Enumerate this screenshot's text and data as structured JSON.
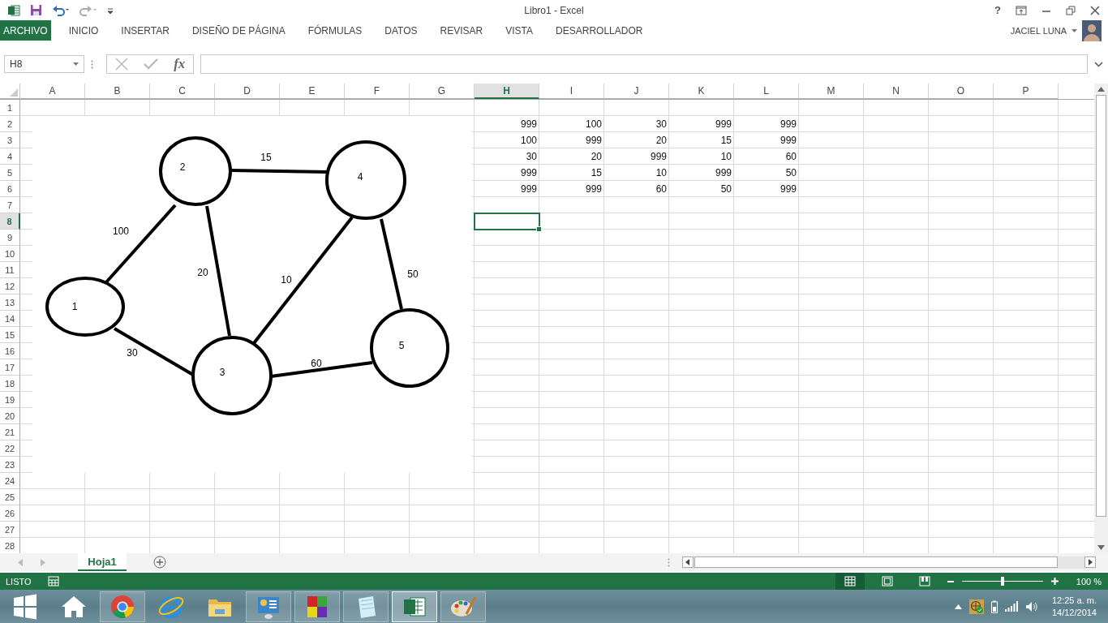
{
  "title_bar": {
    "title": "Libro1 - Excel",
    "help": "?"
  },
  "ribbon_tabs": [
    {
      "label": "ARCHIVO",
      "kind": "file"
    },
    {
      "label": "INICIO",
      "kind": "tab"
    },
    {
      "label": "INSERTAR",
      "kind": "tab"
    },
    {
      "label": "DISEÑO DE PÁGINA",
      "kind": "tab"
    },
    {
      "label": "FÓRMULAS",
      "kind": "tab"
    },
    {
      "label": "DATOS",
      "kind": "tab"
    },
    {
      "label": "REVISAR",
      "kind": "tab"
    },
    {
      "label": "VISTA",
      "kind": "tab"
    },
    {
      "label": "DESARROLLADOR",
      "kind": "tab"
    }
  ],
  "user": {
    "name": "JACIEL LUNA"
  },
  "formula_bar": {
    "name_box": "H8",
    "function_button": "fx"
  },
  "columns": [
    {
      "label": "A",
      "selected": false
    },
    {
      "label": "B",
      "selected": false
    },
    {
      "label": "C",
      "selected": false
    },
    {
      "label": "D",
      "selected": false
    },
    {
      "label": "E",
      "selected": false
    },
    {
      "label": "F",
      "selected": false
    },
    {
      "label": "G",
      "selected": false
    },
    {
      "label": "H",
      "selected": true
    },
    {
      "label": "I",
      "selected": false
    },
    {
      "label": "J",
      "selected": false
    },
    {
      "label": "K",
      "selected": false
    },
    {
      "label": "L",
      "selected": false
    },
    {
      "label": "M",
      "selected": false
    },
    {
      "label": "N",
      "selected": false
    },
    {
      "label": "O",
      "selected": false
    },
    {
      "label": "P",
      "selected": false
    }
  ],
  "rows": [
    {
      "label": "1",
      "selected": false
    },
    {
      "label": "2",
      "selected": false,
      "cells": [
        "999",
        "100",
        "30",
        "999",
        "999"
      ]
    },
    {
      "label": "3",
      "selected": false,
      "cells": [
        "100",
        "999",
        "20",
        "15",
        "999"
      ]
    },
    {
      "label": "4",
      "selected": false,
      "cells": [
        "30",
        "20",
        "999",
        "10",
        "60"
      ]
    },
    {
      "label": "5",
      "selected": false,
      "cells": [
        "999",
        "15",
        "10",
        "999",
        "50"
      ]
    },
    {
      "label": "6",
      "selected": false,
      "cells": [
        "999",
        "999",
        "60",
        "50",
        "999"
      ]
    },
    {
      "label": "7",
      "selected": false
    },
    {
      "label": "8",
      "selected": true
    },
    {
      "label": "9",
      "selected": false
    },
    {
      "label": "10",
      "selected": false
    },
    {
      "label": "11",
      "selected": false
    },
    {
      "label": "12",
      "selected": false
    },
    {
      "label": "13",
      "selected": false
    },
    {
      "label": "14",
      "selected": false
    },
    {
      "label": "15",
      "selected": false
    },
    {
      "label": "16",
      "selected": false
    },
    {
      "label": "17",
      "selected": false
    },
    {
      "label": "18",
      "selected": false
    },
    {
      "label": "19",
      "selected": false
    },
    {
      "label": "20",
      "selected": false
    },
    {
      "label": "21",
      "selected": false
    },
    {
      "label": "22",
      "selected": false
    },
    {
      "label": "23",
      "selected": false
    },
    {
      "label": "24",
      "selected": false
    },
    {
      "label": "25",
      "selected": false
    },
    {
      "label": "26",
      "selected": false
    },
    {
      "label": "27",
      "selected": false
    },
    {
      "label": "28",
      "selected": false
    }
  ],
  "diagram": {
    "nodes": [
      {
        "label": "1"
      },
      {
        "label": "2"
      },
      {
        "label": "3"
      },
      {
        "label": "4"
      },
      {
        "label": "5"
      }
    ],
    "edges": [
      {
        "label": "15"
      },
      {
        "label": "100"
      },
      {
        "label": "20"
      },
      {
        "label": "10"
      },
      {
        "label": "50"
      },
      {
        "label": "30"
      },
      {
        "label": "60"
      }
    ]
  },
  "sheet_tabs": [
    {
      "label": "Hoja1",
      "selected": true
    }
  ],
  "status_bar": {
    "status": "LISTO",
    "zoom": "100 %",
    "zoom_slider": {
      "level": 0.5
    },
    "views": [
      {
        "kind": "normal",
        "selected": true
      },
      {
        "kind": "layout",
        "selected": false
      },
      {
        "kind": "break",
        "selected": false
      }
    ]
  },
  "taskbar": {
    "time": "12:25 a. m.",
    "date": "14/12/2014",
    "apps": [
      {
        "kind": "start",
        "running": false,
        "selected": false
      },
      {
        "kind": "home",
        "running": false,
        "selected": false
      },
      {
        "kind": "chrome",
        "running": true,
        "selected": false
      },
      {
        "kind": "ie",
        "running": false,
        "selected": false
      },
      {
        "kind": "folder",
        "running": false,
        "selected": false
      },
      {
        "kind": "panel",
        "running": true,
        "selected": false
      },
      {
        "kind": "tiles",
        "running": true,
        "selected": false
      },
      {
        "kind": "notepad",
        "running": true,
        "selected": false
      },
      {
        "kind": "sheet",
        "running": true,
        "selected": true
      },
      {
        "kind": "paint",
        "running": true,
        "selected": false
      }
    ]
  }
}
